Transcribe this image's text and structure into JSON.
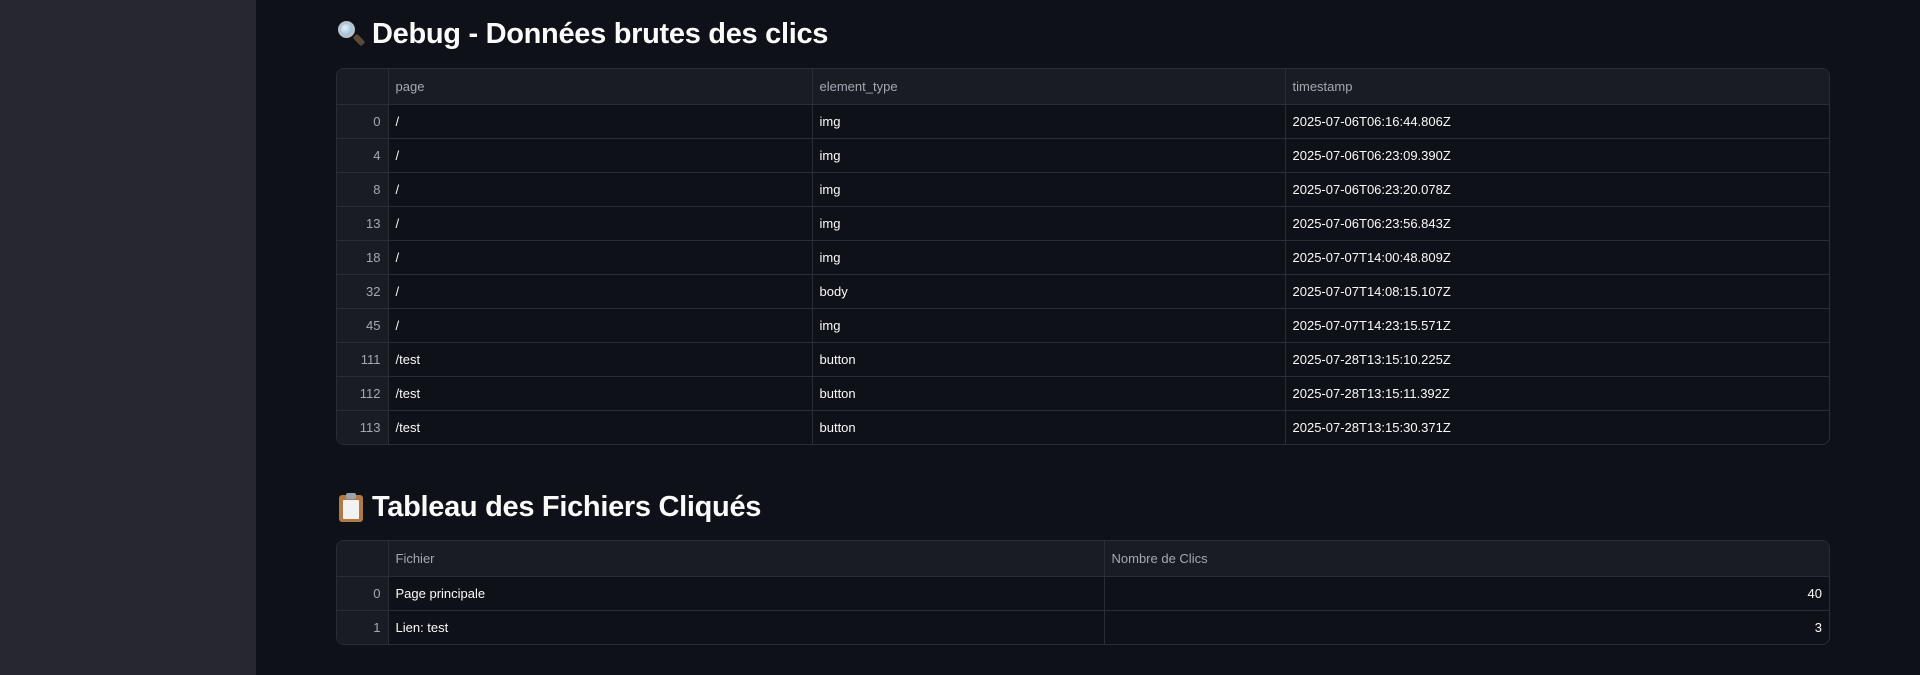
{
  "debug": {
    "title": "Debug - Données brutes des clics",
    "title_icon": "magnifying-glass-icon",
    "columns": [
      "",
      "page",
      "element_type",
      "timestamp"
    ],
    "rows": [
      {
        "index": "0",
        "page": "/",
        "element_type": "img",
        "timestamp": "2025-07-06T06:16:44.806Z"
      },
      {
        "index": "4",
        "page": "/",
        "element_type": "img",
        "timestamp": "2025-07-06T06:23:09.390Z"
      },
      {
        "index": "8",
        "page": "/",
        "element_type": "img",
        "timestamp": "2025-07-06T06:23:20.078Z"
      },
      {
        "index": "13",
        "page": "/",
        "element_type": "img",
        "timestamp": "2025-07-06T06:23:56.843Z"
      },
      {
        "index": "18",
        "page": "/",
        "element_type": "img",
        "timestamp": "2025-07-07T14:00:48.809Z"
      },
      {
        "index": "32",
        "page": "/",
        "element_type": "body",
        "timestamp": "2025-07-07T14:08:15.107Z"
      },
      {
        "index": "45",
        "page": "/",
        "element_type": "img",
        "timestamp": "2025-07-07T14:23:15.571Z"
      },
      {
        "index": "111",
        "page": "/test",
        "element_type": "button",
        "timestamp": "2025-07-28T13:15:10.225Z"
      },
      {
        "index": "112",
        "page": "/test",
        "element_type": "button",
        "timestamp": "2025-07-28T13:15:11.392Z"
      },
      {
        "index": "113",
        "page": "/test",
        "element_type": "button",
        "timestamp": "2025-07-28T13:15:30.371Z"
      }
    ]
  },
  "files": {
    "title": "Tableau des Fichiers Cliqués",
    "title_icon": "clipboard-icon",
    "columns": [
      "",
      "Fichier",
      "Nombre de Clics"
    ],
    "rows": [
      {
        "index": "0",
        "fichier": "Page principale",
        "clics": "40"
      },
      {
        "index": "1",
        "fichier": "Lien: test",
        "clics": "3"
      }
    ]
  },
  "colors": {
    "background": "#0e1117",
    "sidebar": "#262730",
    "header_bg": "#1a1c23",
    "border": "#2b2d36"
  }
}
